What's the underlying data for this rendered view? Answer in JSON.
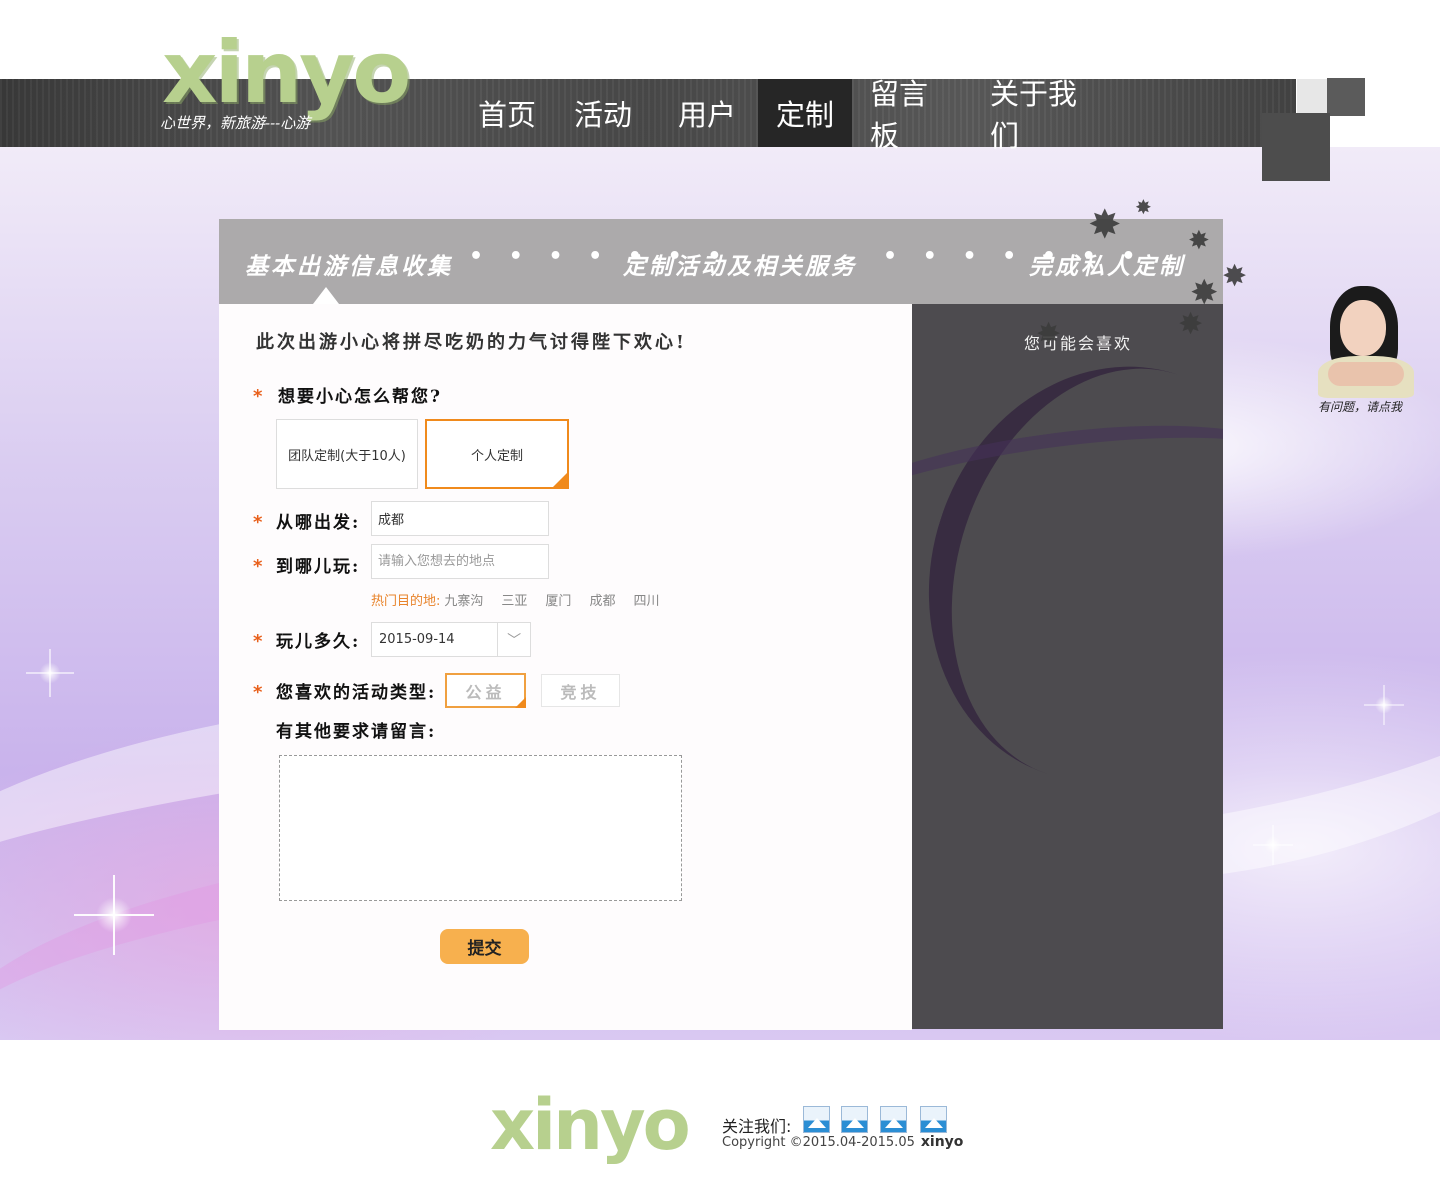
{
  "brand": {
    "logo": "xinyo",
    "tagline": "心世界，新旅游---心游"
  },
  "nav": {
    "items": [
      "首页",
      "活动",
      "用户",
      "定制",
      "留言板",
      "关于我们"
    ],
    "active": "定制"
  },
  "steps": {
    "step1": "基本出游信息收集",
    "step2": "定制活动及相关服务",
    "step3": "完成私人定制",
    "separator": "• • • • • • •"
  },
  "form": {
    "intro": "此次出游小心将拼尽吃奶的力气讨得陛下欢心!",
    "required_mark": "*",
    "help_question": "想要小心怎么帮您?",
    "choices": {
      "team": "团队定制(大于10人)",
      "personal": "个人定制",
      "selected": "个人定制"
    },
    "from_label": "从哪出发:",
    "from_value": "成都",
    "to_label": "到哪儿玩:",
    "to_placeholder": "请输入您想去的地点",
    "hot_label": "热门目的地:",
    "hot_destinations": [
      "九寨沟",
      "三亚",
      "厦门",
      "成都",
      "四川"
    ],
    "duration_label": "玩儿多久:",
    "date_value": "2015-09-14",
    "activity_label": "您喜欢的活动类型:",
    "activity_types": [
      "公益",
      "竞技"
    ],
    "activity_selected": "公益",
    "note_label": "有其他要求请留言:",
    "note_value": "",
    "submit_label": "提交"
  },
  "sidebar": {
    "title": "您可能会喜欢"
  },
  "helper": {
    "text": "有问题，请点我"
  },
  "footer": {
    "logo": "xinyo",
    "follow_label": "关注我们:",
    "social_icons": [
      "image-icon",
      "image-icon",
      "image-icon",
      "image-icon"
    ],
    "copyright": "Copyright  ©2015.04-2015.05",
    "copyright_brand": "xinyo"
  },
  "colors": {
    "accent": "#f08a1c",
    "header": "#4a4a4a",
    "sidebar": "#4d4b4f",
    "submit": "#f7b04e",
    "logo": "#b7d08e"
  }
}
